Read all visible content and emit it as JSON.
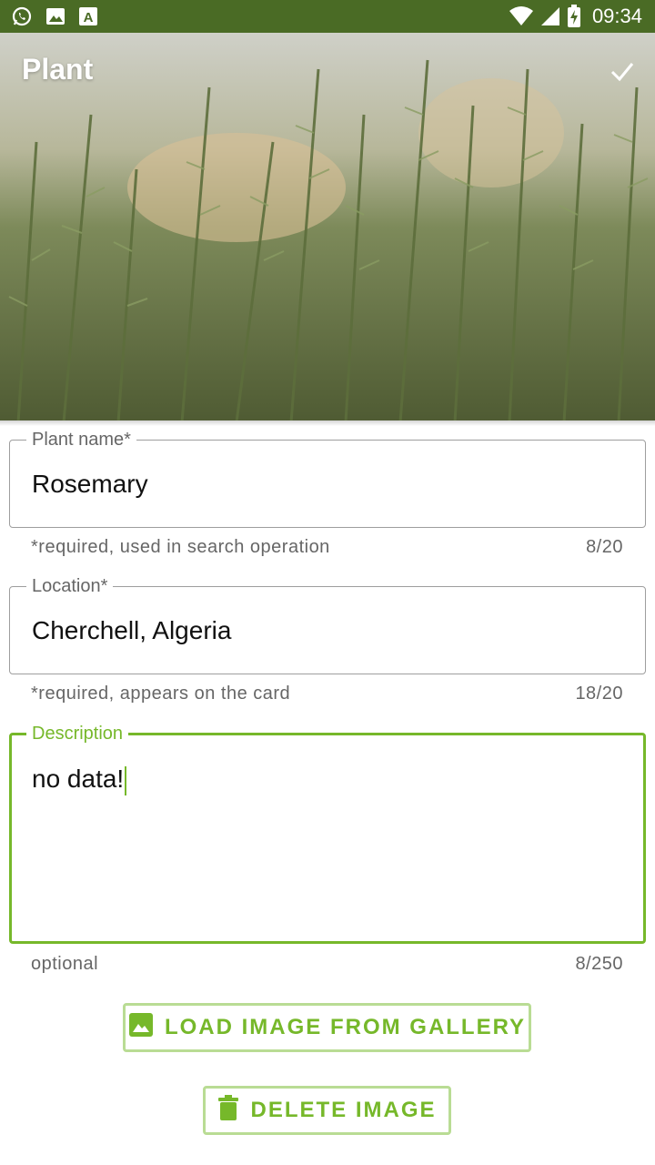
{
  "status_bar": {
    "time": "09:34",
    "left_icons": [
      "whatsapp-icon",
      "image-icon",
      "font-icon"
    ],
    "right_icons": [
      "wifi-icon",
      "signal-icon",
      "battery-charging-icon"
    ]
  },
  "app_bar": {
    "title": "Plant",
    "action_icon": "check-icon"
  },
  "form": {
    "plant_name": {
      "label": "Plant name*",
      "value": "Rosemary",
      "helper": "*required, used in search operation",
      "counter": "8/20"
    },
    "location": {
      "label": "Location*",
      "value": "Cherchell, Algeria",
      "helper": "*required, appears on the card",
      "counter": "18/20"
    },
    "description": {
      "label": "Description",
      "value": "no data!",
      "helper": "optional",
      "counter": "8/250"
    }
  },
  "buttons": {
    "load_image": "LOAD IMAGE FROM GALLERY",
    "delete_image": "DELETE IMAGE"
  },
  "colors": {
    "status_bar": "#4a6b25",
    "accent": "#76b82a",
    "button_border": "#b9dc94"
  }
}
